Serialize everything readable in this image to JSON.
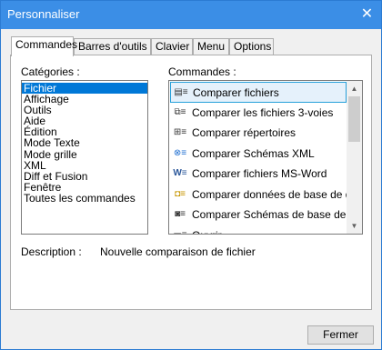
{
  "window": {
    "title": "Personnaliser",
    "close_glyph": "✕"
  },
  "tabs": [
    {
      "label": "Commandes",
      "active": true
    },
    {
      "label": "Barres d'outils",
      "active": false
    },
    {
      "label": "Clavier",
      "active": false
    },
    {
      "label": "Menu",
      "active": false
    },
    {
      "label": "Options",
      "active": false
    }
  ],
  "categories": {
    "label": "Catégories :",
    "items": [
      "Fichier",
      "Affichage",
      "Outils",
      "Aide",
      "Édition",
      "Mode Texte",
      "Mode grille",
      "XML",
      "Diff et Fusion",
      "Fenêtre",
      "Toutes les commandes"
    ],
    "selected_index": 0
  },
  "commands": {
    "label": "Commandes :",
    "items": [
      {
        "label": "Comparer fichiers",
        "icon": "compare-files-icon"
      },
      {
        "label": "Comparer les fichiers 3-voies",
        "icon": "compare-3way-icon"
      },
      {
        "label": "Comparer répertoires",
        "icon": "compare-dirs-icon"
      },
      {
        "label": "Comparer Schémas XML",
        "icon": "compare-xml-schemas-icon"
      },
      {
        "label": "Comparer fichiers MS-Word",
        "icon": "word-icon"
      },
      {
        "label": "Comparer données de base de donn",
        "icon": "database-icon"
      },
      {
        "label": "Comparer Schémas de base de don",
        "icon": "database-schema-icon"
      },
      {
        "label": "Ouvrir",
        "icon": "open-icon"
      }
    ],
    "selected_index": 0
  },
  "description": {
    "label": "Description :",
    "value": "Nouvelle comparaison de fichier"
  },
  "footer": {
    "close_label": "Fermer"
  }
}
